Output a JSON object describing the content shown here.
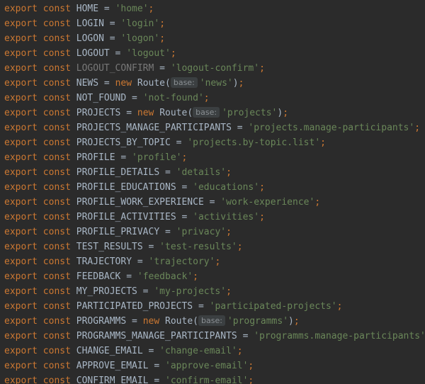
{
  "editor": {
    "keywords": {
      "export": "export",
      "const": "const",
      "new": "new"
    },
    "lines": [
      {
        "name": "HOME",
        "value": "'home'"
      },
      {
        "name": "LOGIN",
        "value": "'login'"
      },
      {
        "name": "LOGON",
        "value": "'logon'"
      },
      {
        "name": "LOGOUT",
        "value": "'logout'"
      },
      {
        "name": "LOGOUT_CONFIRM",
        "value": "'logout-confirm'",
        "unused": true
      },
      {
        "name": "NEWS",
        "route": true,
        "hint": "base:",
        "value": "'news'"
      },
      {
        "name": "NOT_FOUND",
        "value": "'not-found'"
      },
      {
        "name": "PROJECTS",
        "route": true,
        "hint": "base:",
        "value": "'projects'"
      },
      {
        "name": "PROJECTS_MANAGE_PARTICIPANTS",
        "value": "'projects.manage-participants'"
      },
      {
        "name": "PROJECTS_BY_TOPIC",
        "value": "'projects.by-topic.list'"
      },
      {
        "name": "PROFILE",
        "value": "'profile'"
      },
      {
        "name": "PROFILE_DETAILS",
        "value": "'details'"
      },
      {
        "name": "PROFILE_EDUCATIONS",
        "value": "'educations'"
      },
      {
        "name": "PROFILE_WORK_EXPERIENCE",
        "value": "'work-experience'"
      },
      {
        "name": "PROFILE_ACTIVITIES",
        "value": "'activities'"
      },
      {
        "name": "PROFILE_PRIVACY",
        "value": "'privacy'"
      },
      {
        "name": "TEST_RESULTS",
        "value": "'test-results'"
      },
      {
        "name": "TRAJECTORY",
        "value": "'trajectory'"
      },
      {
        "name": "FEEDBACK",
        "value": "'feedback'"
      },
      {
        "name": "MY_PROJECTS",
        "value": "'my-projects'"
      },
      {
        "name": "PARTICIPATED_PROJECTS",
        "value": "'participated-projects'"
      },
      {
        "name": "PROGRAMMS",
        "route": true,
        "hint": "base:",
        "value": "'programms'"
      },
      {
        "name": "PROGRAMMS_MANAGE_PARTICIPANTS",
        "value": "'programms.manage-participants'"
      },
      {
        "name": "CHANGE_EMAIL",
        "value": "'change-email'"
      },
      {
        "name": "APPROVE_EMAIL",
        "value": "'approve-email'"
      },
      {
        "name": "CONFIRM_EMAIL",
        "value": "'confirm-email'"
      }
    ],
    "route_class": "Route",
    "colors": {
      "background": "#2b2b2b",
      "keyword": "#cc7832",
      "identifier": "#a9b7c6",
      "unused_identifier": "#787878",
      "string": "#6a8759",
      "hint_background": "#3b3f41",
      "hint_text": "#8a8f93"
    }
  }
}
